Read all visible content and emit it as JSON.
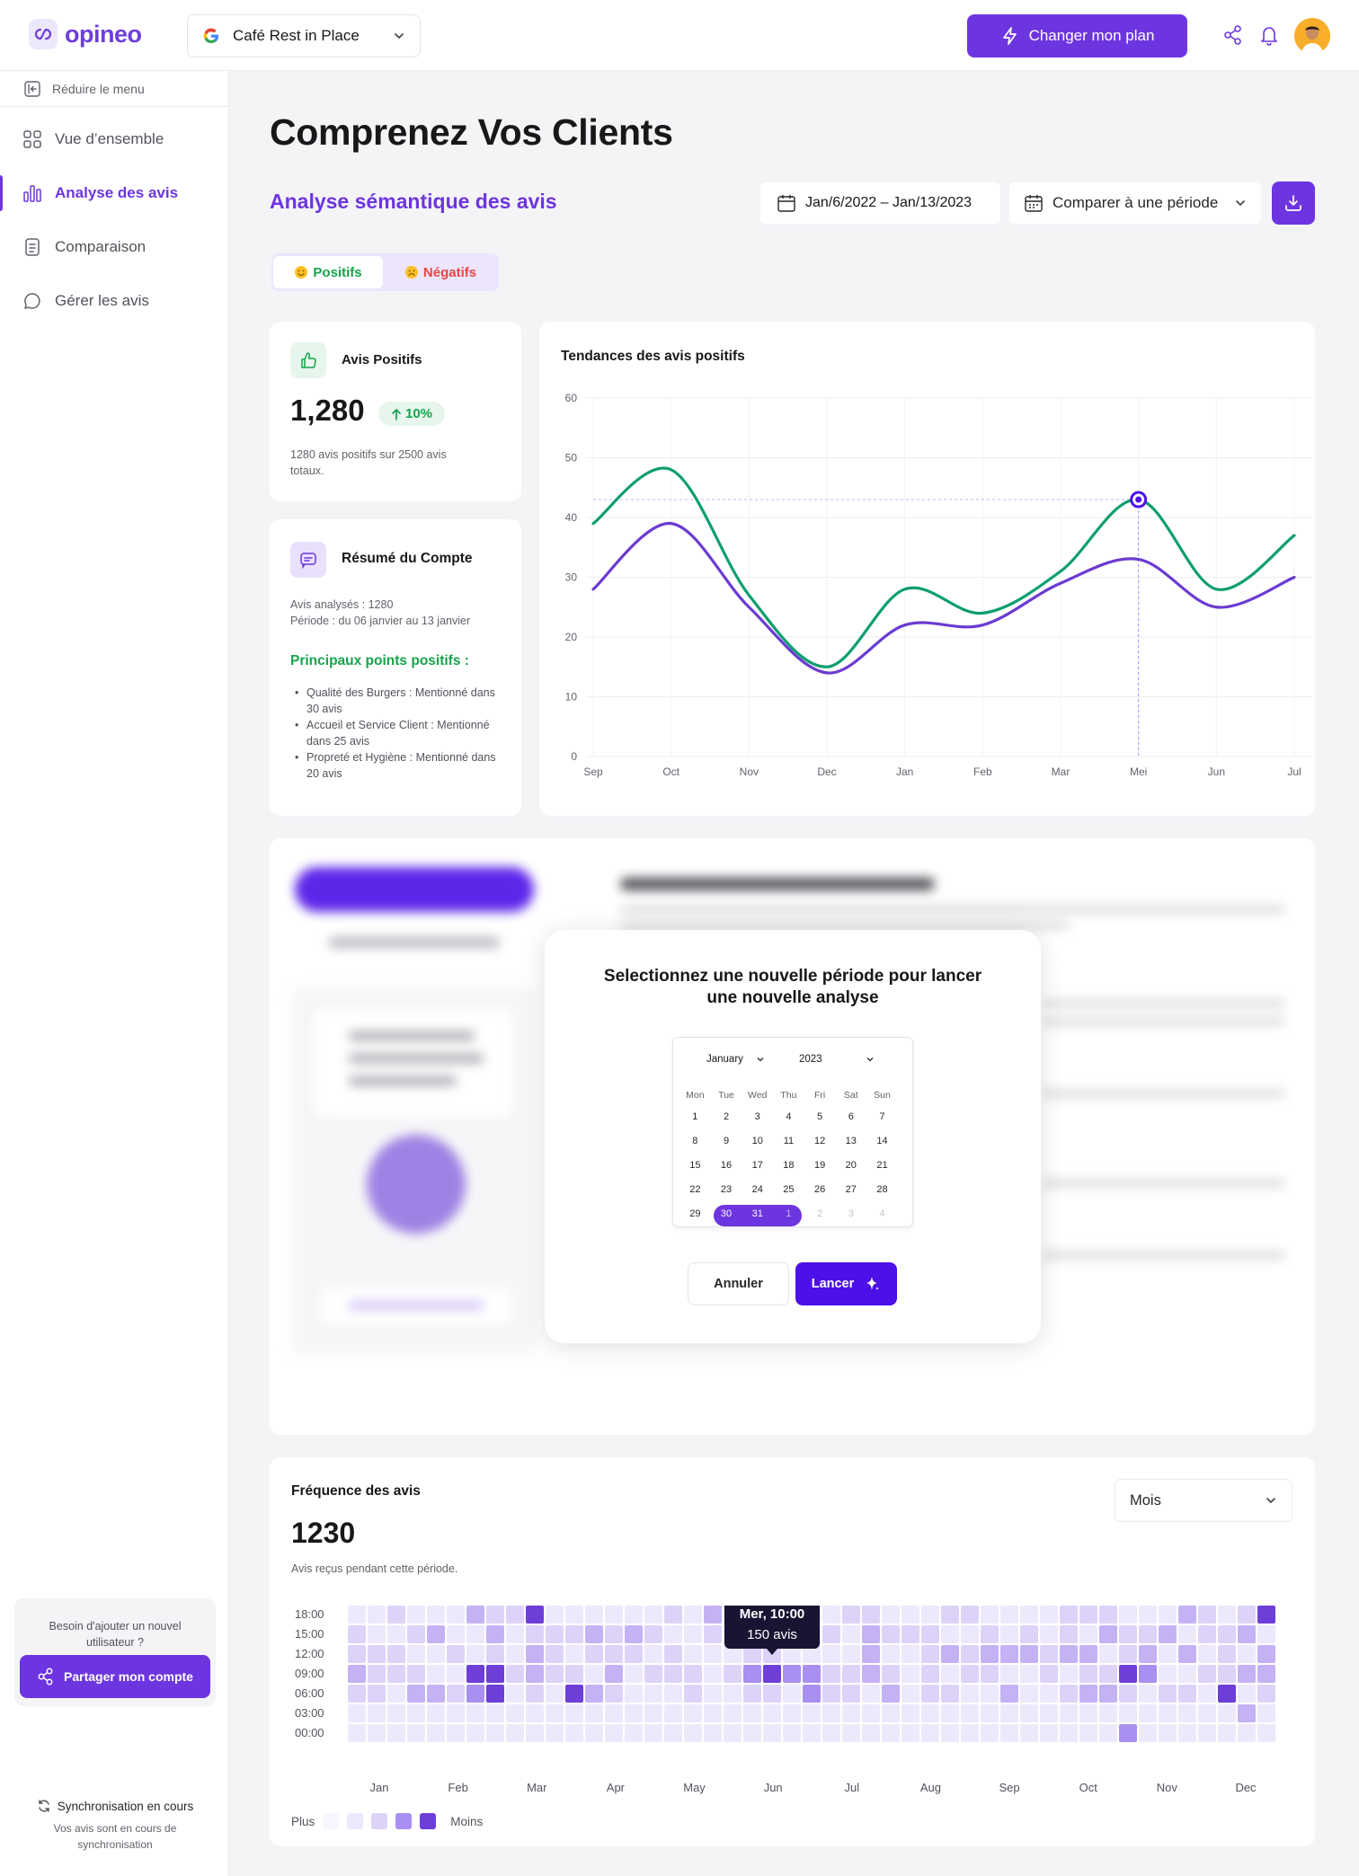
{
  "app": {
    "name": "opineo"
  },
  "header": {
    "business": "Café Rest in Place",
    "plan_label": "Changer mon plan"
  },
  "sidebar": {
    "collapse_label": "Réduire le menu",
    "items": [
      {
        "label": "Vue d’ensemble",
        "active": false
      },
      {
        "label": "Analyse des avis",
        "active": true
      },
      {
        "label": "Comparaison",
        "active": false
      },
      {
        "label": "Gérer les avis",
        "active": false
      }
    ],
    "invite_text": "Besoin d'ajouter un nouvel utilisateur ?",
    "share_label": "Partager mon compte",
    "sync_title": "Synchronisation en cours",
    "sync_sub": "Vos avis sont en cours de synchronisation"
  },
  "page": {
    "title": "Comprenez Vos Clients",
    "section": "Analyse sémantique des avis",
    "date_range": "Jan/6/2022 – Jan/13/2023",
    "compare_label": "Comparer à une période"
  },
  "tabs": {
    "positive": "Positifs",
    "negative": "Négatifs"
  },
  "kpi": {
    "label": "Avis Positifs",
    "value": "1,280",
    "delta": "10%",
    "note": "1280 avis positifs sur 2500 avis totaux."
  },
  "summary": {
    "title": "Résumé du Compte",
    "analysed": "Avis analysés : 1280",
    "period": "Période : du 06 janvier au 13 janvier",
    "highlights_title": "Principaux points positifs :",
    "highlights": [
      "Qualité des Burgers : Mentionné dans 30 avis",
      "Accueil et Service Client : Mentionné dans 25 avis",
      "Propreté et Hygiène : Mentionné dans 20 avis"
    ]
  },
  "chart_data": {
    "type": "line",
    "title": "Tendances des avis positifs",
    "categories": [
      "Sep",
      "Oct",
      "Nov",
      "Dec",
      "Jan",
      "Feb",
      "Mar",
      "Mei",
      "Jun",
      "Jul"
    ],
    "ylim": [
      0,
      60
    ],
    "yticks": [
      0,
      10,
      20,
      30,
      40,
      50,
      60
    ],
    "grid": true,
    "highlight": {
      "category": "Mei",
      "value": 43
    },
    "series": [
      {
        "color": "#0e9f6e",
        "values": [
          39,
          48,
          27,
          15,
          28,
          24,
          31,
          43,
          28,
          37
        ]
      },
      {
        "color": "#6a3bd2",
        "values": [
          28,
          39,
          25,
          14,
          22,
          22,
          29,
          33,
          25,
          30
        ]
      }
    ]
  },
  "modal": {
    "title": "Selectionnez une nouvelle période pour lancer une nouvelle analyse",
    "month": "January",
    "year": "2023",
    "weekdays": [
      "Mon",
      "Tue",
      "Wed",
      "Thu",
      "Fri",
      "Sat",
      "Sun"
    ],
    "weeks": [
      [
        "1",
        "2",
        "3",
        "4",
        "5",
        "6",
        "7"
      ],
      [
        "8",
        "9",
        "10",
        "11",
        "12",
        "13",
        "14"
      ],
      [
        "15",
        "16",
        "17",
        "18",
        "19",
        "20",
        "21"
      ],
      [
        "22",
        "23",
        "24",
        "25",
        "26",
        "27",
        "28"
      ],
      [
        "29",
        "30",
        "31",
        "1",
        "2",
        "3",
        "4"
      ]
    ],
    "selected_range": {
      "week": 4,
      "from": 1,
      "to": 3
    },
    "muted_from": {
      "week": 4,
      "day": 3
    },
    "cancel_label": "Annuler",
    "launch_label": "Lancer"
  },
  "frequency": {
    "title": "Fréquence des avis",
    "value": "1230",
    "note": "Avis reçus pendant cette période.",
    "granularity": "Mois",
    "tooltip": {
      "title": "Mer, 10:00",
      "value": "150 avis",
      "week": 21,
      "row": 3
    },
    "legend_more": "Plus",
    "legend_less": "Moins",
    "palette": [
      "#f7f5fd",
      "#ede8fc",
      "#ddd3f8",
      "#c4b2f4",
      "#a98ff0",
      "#6d3fd8"
    ]
  },
  "heatmap_data": {
    "type": "heatmap",
    "rows": [
      "18:00",
      "15:00",
      "12:00",
      "09:00",
      "06:00",
      "03:00",
      "00:00"
    ],
    "months": [
      "Jan",
      "Feb",
      "Mar",
      "Apr",
      "May",
      "Jun",
      "Jul",
      "Aug",
      "Sep",
      "Oct",
      "Nov",
      "Dec"
    ],
    "weeks": 47,
    "levels": [
      [
        1,
        1,
        2,
        1,
        1,
        1,
        3,
        2,
        2,
        2,
        1,
        1,
        1,
        1,
        1,
        1,
        2,
        1,
        3,
        1,
        2,
        2,
        1,
        1,
        1,
        2,
        2,
        1,
        1,
        1,
        2,
        2,
        1,
        1,
        1,
        1,
        2,
        2,
        2,
        1,
        1,
        1,
        3,
        2,
        1,
        2,
        1,
        1,
        3,
        2,
        2
      ],
      [
        2,
        1,
        1,
        2,
        3,
        1,
        1,
        3,
        1,
        2,
        2,
        2,
        3,
        2,
        3,
        2,
        1,
        1,
        2,
        1,
        2,
        1,
        1,
        1,
        2,
        1,
        3,
        2,
        2,
        2,
        1,
        1,
        2,
        1,
        2,
        1,
        2,
        1,
        3,
        2,
        2,
        3,
        1,
        2,
        2,
        3,
        1,
        2,
        2
      ],
      [
        2,
        2,
        2,
        1,
        1,
        2,
        1,
        2,
        1,
        3,
        2,
        1,
        2,
        2,
        2,
        1,
        2,
        1,
        1,
        1,
        2,
        2,
        1,
        1,
        1,
        1,
        3,
        1,
        1,
        2,
        3,
        2,
        3,
        3,
        3,
        2,
        3,
        3,
        1,
        2,
        3,
        1,
        3,
        1,
        2,
        1,
        3,
        1,
        2,
        3
      ],
      [
        3,
        2,
        2,
        2,
        1,
        1,
        5,
        2,
        2,
        3,
        2,
        2,
        1,
        3,
        1,
        2,
        2,
        2,
        1,
        2,
        4,
        2,
        1,
        4,
        2,
        2,
        3,
        2,
        1,
        2,
        1,
        2,
        2,
        1,
        1,
        2,
        1,
        2,
        2,
        3,
        4,
        1,
        1,
        2,
        2,
        3,
        3,
        2,
        2
      ],
      [
        2,
        2,
        1,
        3,
        3,
        2,
        4,
        1,
        1,
        2,
        1,
        5,
        3,
        2,
        1,
        1,
        1,
        2,
        1,
        1,
        2,
        2,
        1,
        3,
        2,
        2,
        1,
        3,
        1,
        2,
        2,
        1,
        1,
        3,
        1,
        1,
        2,
        3,
        3,
        2,
        1,
        2,
        2,
        1,
        1,
        1,
        2,
        4,
        2,
        2
      ],
      [
        1,
        1,
        1,
        1,
        1,
        1,
        1,
        1,
        1,
        1,
        1,
        1,
        1,
        1,
        1,
        1,
        1,
        1,
        1,
        1,
        1,
        1,
        1,
        1,
        1,
        1,
        1,
        1,
        1,
        1,
        1,
        1,
        1,
        1,
        1,
        1,
        1,
        1,
        1,
        1,
        1,
        1,
        1,
        1,
        1,
        3,
        1,
        1,
        1
      ],
      [
        1,
        1,
        1,
        1,
        1,
        1,
        1,
        1,
        1,
        1,
        1,
        1,
        1,
        1,
        1,
        1,
        1,
        1,
        1,
        1,
        1,
        1,
        1,
        1,
        1,
        1,
        1,
        1,
        1,
        1,
        1,
        1,
        1,
        1,
        1,
        1,
        1,
        1,
        1,
        4,
        1,
        1,
        1,
        1,
        1,
        1,
        1,
        1,
        1
      ]
    ],
    "highlights": [
      {
        "week": 9,
        "row": 0,
        "level": 5
      },
      {
        "week": 46,
        "row": 0,
        "level": 5
      },
      {
        "week": 7,
        "row": 3,
        "level": 5
      },
      {
        "week": 21,
        "row": 3,
        "level": 5
      },
      {
        "week": 22,
        "row": 3,
        "level": 4
      },
      {
        "week": 23,
        "row": 3,
        "level": 4
      },
      {
        "week": 39,
        "row": 3,
        "level": 5
      },
      {
        "week": 7,
        "row": 4,
        "level": 5
      },
      {
        "week": 11,
        "row": 4,
        "level": 5
      },
      {
        "week": 23,
        "row": 4,
        "level": 4
      },
      {
        "week": 44,
        "row": 4,
        "level": 5
      }
    ]
  }
}
